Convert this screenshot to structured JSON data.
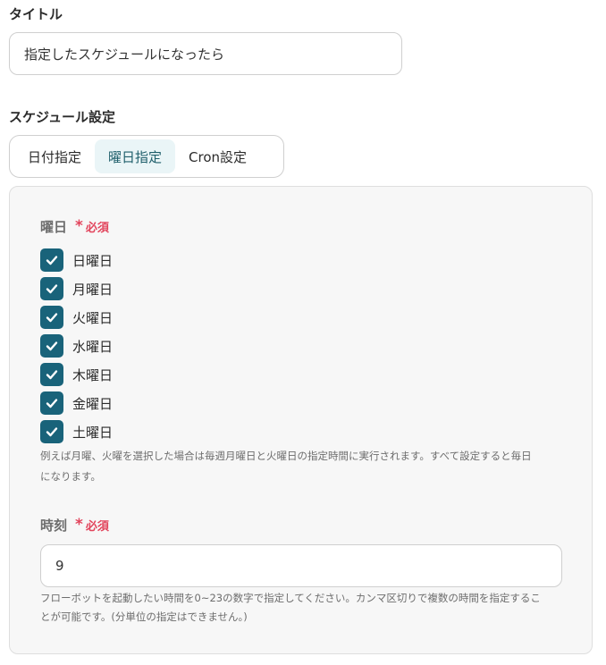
{
  "title_field": {
    "label": "タイトル",
    "value": "指定したスケジュールになったら"
  },
  "schedule": {
    "label": "スケジュール設定",
    "tabs": [
      {
        "label": "日付指定",
        "active": false
      },
      {
        "label": "曜日指定",
        "active": true
      },
      {
        "label": "Cron設定",
        "active": false
      }
    ]
  },
  "weekday_field": {
    "label": "曜日",
    "required_mark": "*",
    "required_label": "必須",
    "days": [
      {
        "label": "日曜日",
        "checked": true
      },
      {
        "label": "月曜日",
        "checked": true
      },
      {
        "label": "火曜日",
        "checked": true
      },
      {
        "label": "水曜日",
        "checked": true
      },
      {
        "label": "木曜日",
        "checked": true
      },
      {
        "label": "金曜日",
        "checked": true
      },
      {
        "label": "土曜日",
        "checked": true
      }
    ],
    "help_line1": "例えば月曜、火曜を選択した場合は毎週月曜日と火曜日の指定時間に実行されます。すべて設定すると毎日",
    "help_line2": "になります。"
  },
  "time_field": {
    "label": "時刻",
    "required_mark": "*",
    "required_label": "必須",
    "value": "9",
    "help_line1": "フローボットを起動したい時間を0~23の数字で指定してください。カンマ区切りで複数の時間を指定するこ",
    "help_line2": "とが可能です。(分単位の指定はできません。)"
  },
  "colors": {
    "accent": "#19637a",
    "required": "#e2445c",
    "active_tab_bg": "#eaf5f7"
  }
}
